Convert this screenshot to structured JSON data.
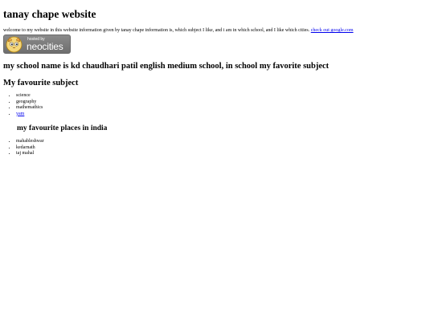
{
  "page": {
    "title": "tanay chape website",
    "intro_text": "welcome to my website in this website information given by tanay chape information is, which subject I like, and i am in which school, and I like which cities.",
    "intro_link": "check out google.com"
  },
  "badge": {
    "hosted_by": "hosted by",
    "brand": "neocities",
    "icon": "neocities-cat-icon"
  },
  "school": {
    "heading": "my school name is kd chaudhari patil english medium school, in school my favorite subject"
  },
  "subjects": {
    "heading": "My favourite subject",
    "items": [
      {
        "label": "science",
        "link": false
      },
      {
        "label": "geography",
        "link": false
      },
      {
        "label": "mathemathics",
        "link": false
      },
      {
        "label": "yam",
        "link": true
      }
    ]
  },
  "places": {
    "heading": "my favourite places in india",
    "items": [
      "mahableshwar",
      "kedarnath",
      "taj mahal"
    ]
  },
  "colors": {
    "link": "#0000ee",
    "badge_bg": "#7a7a7a"
  }
}
